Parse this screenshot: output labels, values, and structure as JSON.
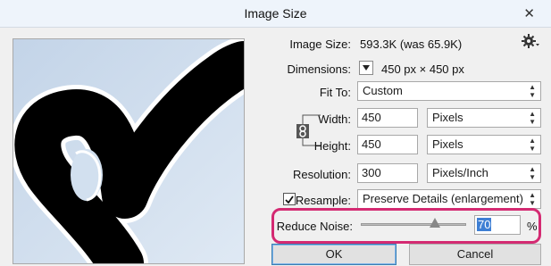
{
  "window": {
    "title": "Image Size",
    "close_label": "✕"
  },
  "image_size": {
    "label": "Image Size:",
    "value": "593.3K (was 65.9K)"
  },
  "dimensions": {
    "label": "Dimensions:",
    "value": "450 px  ×  450 px"
  },
  "fit_to": {
    "label": "Fit To:",
    "value": "Custom"
  },
  "width": {
    "label": "Width:",
    "value": "450",
    "unit": "Pixels"
  },
  "height": {
    "label": "Height:",
    "value": "450",
    "unit": "Pixels"
  },
  "resolution": {
    "label": "Resolution:",
    "value": "300",
    "unit": "Pixels/Inch"
  },
  "resample": {
    "label": "Resample:",
    "checked": true,
    "value": "Preserve Details (enlargement)"
  },
  "reduce_noise": {
    "label": "Reduce Noise:",
    "value": "70",
    "unit": "%",
    "slider_fraction": 0.7
  },
  "buttons": {
    "ok": "OK",
    "cancel": "Cancel"
  },
  "icons": {
    "settings": "gear-icon",
    "constrain": "chain-link-icon",
    "dimensions_menu": "dropdown-triangle-icon"
  }
}
